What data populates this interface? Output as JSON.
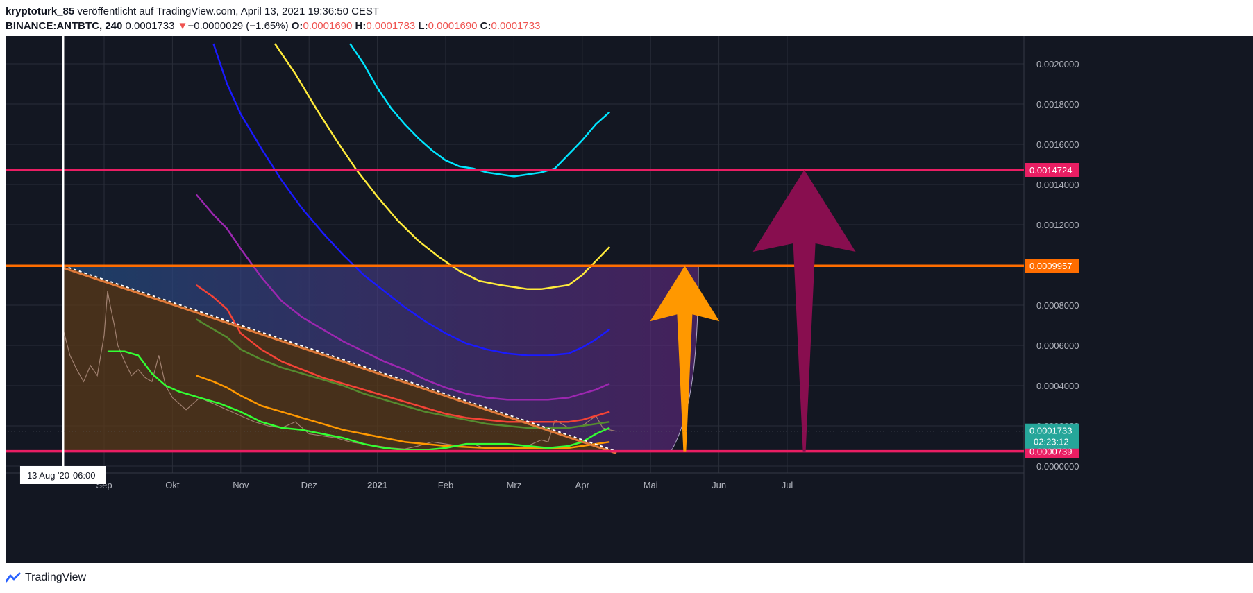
{
  "header": {
    "author": "kryptoturk_85",
    "published": "veröffentlicht auf TradingView.com, April 13, 2021 19:36:50 CEST",
    "symbol": "BINANCE:ANTBTC, 240",
    "last": "0.0001733",
    "change_arrow": "▼",
    "change": "−0.0000029 (−1.65%)",
    "o_label": "O:",
    "o_value": "0.0001690",
    "h_label": "H:",
    "h_value": "0.0001783",
    "l_label": "L:",
    "l_value": "0.0001690",
    "c_label": "C:",
    "c_value": "0.0001733"
  },
  "footer": {
    "brand": "TradingView",
    "logo_icon": "tradingview-logo-icon"
  },
  "colors": {
    "background": "#131722",
    "grid": "#2a2e39",
    "text": "#b2b5be",
    "magenta_line": "#e91e63",
    "orange_line": "#ff6d00",
    "orange_arrow": "#ff9800",
    "purple_arrow": "#880e4f",
    "price_tag": "#26a69a"
  },
  "chart_data": {
    "type": "line",
    "title": "",
    "ylim": [
      0,
      0.0021
    ],
    "ytick_labels": [
      "0.0020000",
      "0.0018000",
      "0.0016000",
      "0.0014000",
      "0.0012000",
      "0.0010000",
      "0.0008000",
      "0.0006000",
      "0.0004000",
      "0.0002000",
      "0.0000000"
    ],
    "yticks": [
      0.002,
      0.0018,
      0.0016,
      0.0014,
      0.0012,
      0.001,
      0.0008,
      0.0006,
      0.0004,
      0.0002,
      0
    ],
    "x_labels": [
      "Sep",
      "Okt",
      "Nov",
      "Dez",
      "2021",
      "Feb",
      "Mrz",
      "Apr",
      "Mai",
      "Jun",
      "Jul"
    ],
    "x_label_months": [
      1,
      2,
      3,
      4,
      5,
      6,
      7,
      8,
      9,
      10,
      11
    ],
    "crosshair_date": "13 Aug '20",
    "crosshair_time": "06:00",
    "crosshair_month": 0.4,
    "horizontal_levels": [
      {
        "value": 0.0014724,
        "label": "0.0014724",
        "color": "#e91e63"
      },
      {
        "value": 0.0009957,
        "label": "0.0009957",
        "color": "#ff6d00"
      },
      {
        "value": 7.39e-05,
        "label": "0.0000739",
        "color": "#e91e63"
      }
    ],
    "last_price": {
      "value": 0.0001733,
      "label": "0.0001733",
      "countdown": "02:23:12"
    },
    "triangle": {
      "start_month": 0.4,
      "top": 0.0009957,
      "bottom": 7.39e-05,
      "apex_month": 8.5
    },
    "price": {
      "x": [
        0.4,
        0.5,
        0.6,
        0.7,
        0.8,
        0.9,
        1.0,
        1.05,
        1.1,
        1.15,
        1.2,
        1.3,
        1.4,
        1.5,
        1.6,
        1.7,
        1.8,
        1.9,
        2.0,
        2.2,
        2.4,
        2.6,
        2.8,
        3.0,
        3.2,
        3.4,
        3.6,
        3.8,
        4.0,
        4.2,
        4.4,
        4.6,
        4.8,
        5.0,
        5.2,
        5.4,
        5.6,
        5.8,
        6.0,
        6.2,
        6.4,
        6.6,
        6.8,
        7.0,
        7.2,
        7.4,
        7.5,
        7.6,
        7.8,
        8.0,
        8.2,
        8.3,
        8.4,
        8.5
      ],
      "y": [
        0.00068,
        0.00055,
        0.00048,
        0.00042,
        0.0005,
        0.00045,
        0.00065,
        0.00087,
        0.00078,
        0.0007,
        0.0006,
        0.00052,
        0.00045,
        0.00048,
        0.00044,
        0.00042,
        0.00055,
        0.0004,
        0.00034,
        0.00028,
        0.00034,
        0.00031,
        0.00028,
        0.00025,
        0.00022,
        0.0002,
        0.00019,
        0.00022,
        0.00016,
        0.00015,
        0.00014,
        0.00012,
        0.00011,
        0.0001,
        9e-05,
        8.5e-05,
        0.0001,
        0.00012,
        0.00011,
        0.0001,
        0.00011,
        8.5e-05,
        9e-05,
        8.5e-05,
        0.0001,
        0.00013,
        0.00012,
        0.00023,
        0.00019,
        0.0002,
        0.00025,
        0.00019,
        0.00018,
        0.000173
      ]
    },
    "series": [
      {
        "color": "#00e5ff",
        "x": [
          4.6,
          4.8,
          5.0,
          5.2,
          5.4,
          5.6,
          5.8,
          6.0,
          6.2,
          6.4,
          6.6,
          6.8,
          7.0,
          7.2,
          7.4,
          7.6,
          7.8,
          8.0,
          8.2,
          8.4
        ],
        "y": [
          0.0021,
          0.002,
          0.00188,
          0.00178,
          0.0017,
          0.00163,
          0.00157,
          0.00152,
          0.00149,
          0.00148,
          0.00146,
          0.00145,
          0.00144,
          0.00145,
          0.00146,
          0.00148,
          0.00155,
          0.00162,
          0.0017,
          0.00176
        ]
      },
      {
        "color": "#ffeb3b",
        "x": [
          3.5,
          3.8,
          4.1,
          4.4,
          4.7,
          5.0,
          5.3,
          5.6,
          5.9,
          6.2,
          6.5,
          6.8,
          7.0,
          7.2,
          7.4,
          7.6,
          7.8,
          8.0,
          8.2,
          8.4
        ],
        "y": [
          0.0021,
          0.00195,
          0.00178,
          0.00162,
          0.00147,
          0.00134,
          0.00122,
          0.00112,
          0.00104,
          0.00097,
          0.00092,
          0.0009,
          0.00089,
          0.00088,
          0.00088,
          0.00089,
          0.0009,
          0.00095,
          0.00102,
          0.00109
        ]
      },
      {
        "color": "#1a1aff",
        "x": [
          2.6,
          2.8,
          3.0,
          3.3,
          3.6,
          3.9,
          4.2,
          4.5,
          4.8,
          5.1,
          5.4,
          5.7,
          6.0,
          6.3,
          6.6,
          6.9,
          7.2,
          7.5,
          7.8,
          8.0,
          8.2,
          8.4
        ],
        "y": [
          0.0021,
          0.0019,
          0.00175,
          0.00158,
          0.00142,
          0.00128,
          0.00116,
          0.00105,
          0.00095,
          0.00087,
          0.00079,
          0.00072,
          0.00066,
          0.00061,
          0.00058,
          0.00056,
          0.00055,
          0.00055,
          0.00056,
          0.00059,
          0.00063,
          0.00068
        ]
      },
      {
        "color": "#9c27b0",
        "x": [
          2.35,
          2.6,
          2.8,
          3.0,
          3.3,
          3.6,
          3.9,
          4.2,
          4.5,
          4.8,
          5.1,
          5.4,
          5.7,
          6.0,
          6.3,
          6.6,
          6.9,
          7.2,
          7.5,
          7.8,
          8.0,
          8.2,
          8.4
        ],
        "y": [
          0.00135,
          0.00125,
          0.00118,
          0.00108,
          0.00094,
          0.00082,
          0.00074,
          0.00068,
          0.00062,
          0.00057,
          0.00052,
          0.00048,
          0.00043,
          0.00039,
          0.00036,
          0.00034,
          0.00033,
          0.00033,
          0.00033,
          0.00034,
          0.00036,
          0.00038,
          0.00041
        ]
      },
      {
        "color": "#f44336",
        "x": [
          2.35,
          2.6,
          2.8,
          3.0,
          3.3,
          3.6,
          3.9,
          4.2,
          4.5,
          4.8,
          5.1,
          5.4,
          5.7,
          6.0,
          6.3,
          6.6,
          6.9,
          7.2,
          7.5,
          7.8,
          8.0,
          8.2,
          8.4
        ],
        "y": [
          0.0009,
          0.00084,
          0.00078,
          0.00066,
          0.00058,
          0.00052,
          0.00048,
          0.00044,
          0.00041,
          0.00038,
          0.00035,
          0.00032,
          0.00029,
          0.00026,
          0.00024,
          0.00023,
          0.00022,
          0.00022,
          0.00022,
          0.00022,
          0.00023,
          0.00025,
          0.00027
        ]
      },
      {
        "color": "#558b2f",
        "x": [
          2.35,
          2.6,
          2.8,
          3.0,
          3.3,
          3.6,
          3.9,
          4.2,
          4.5,
          4.8,
          5.1,
          5.4,
          5.7,
          6.0,
          6.3,
          6.6,
          6.9,
          7.2,
          7.5,
          7.8,
          8.0,
          8.2,
          8.4
        ],
        "y": [
          0.00073,
          0.00068,
          0.00064,
          0.00058,
          0.00053,
          0.00049,
          0.00046,
          0.00043,
          0.0004,
          0.00036,
          0.00033,
          0.0003,
          0.00027,
          0.00025,
          0.00023,
          0.00021,
          0.0002,
          0.00019,
          0.00019,
          0.00019,
          0.0002,
          0.00021,
          0.00022
        ]
      },
      {
        "color": "#ff9800",
        "x": [
          2.35,
          2.6,
          2.8,
          3.0,
          3.3,
          3.6,
          3.9,
          4.2,
          4.5,
          4.8,
          5.1,
          5.4,
          5.7,
          6.0,
          6.3,
          6.6,
          6.9,
          7.2,
          7.5,
          7.8,
          8.0,
          8.2,
          8.4
        ],
        "y": [
          0.00045,
          0.00042,
          0.00039,
          0.00035,
          0.0003,
          0.00027,
          0.00024,
          0.00021,
          0.00018,
          0.00016,
          0.00014,
          0.00012,
          0.00011,
          0.0001,
          9.5e-05,
          9e-05,
          9e-05,
          9e-05,
          9e-05,
          9e-05,
          0.0001,
          0.00011,
          0.00012
        ]
      },
      {
        "color": "#33ff33",
        "x": [
          1.05,
          1.3,
          1.5,
          1.7,
          1.9,
          2.1,
          2.4,
          2.7,
          3.0,
          3.3,
          3.6,
          3.9,
          4.2,
          4.5,
          4.8,
          5.1,
          5.4,
          5.7,
          6.0,
          6.3,
          6.6,
          6.9,
          7.2,
          7.5,
          7.8,
          8.0,
          8.2,
          8.4
        ],
        "y": [
          0.00057,
          0.00057,
          0.00055,
          0.00046,
          0.0004,
          0.00037,
          0.00034,
          0.00031,
          0.00027,
          0.00022,
          0.00019,
          0.00018,
          0.00016,
          0.00014,
          0.00011,
          9e-05,
          8e-05,
          8e-05,
          9e-05,
          0.00011,
          0.00011,
          0.00011,
          0.0001,
          9e-05,
          0.0001,
          0.00012,
          0.00016,
          0.00019
        ]
      }
    ],
    "arrows": [
      {
        "name": "orange-arrow",
        "month": 9.5,
        "from": 7.39e-05,
        "to": 0.0009957,
        "color": "#ff9800"
      },
      {
        "name": "purple-arrow",
        "month": 11.25,
        "from": 7.39e-05,
        "to": 0.0014724,
        "color": "#880e4f"
      }
    ]
  }
}
